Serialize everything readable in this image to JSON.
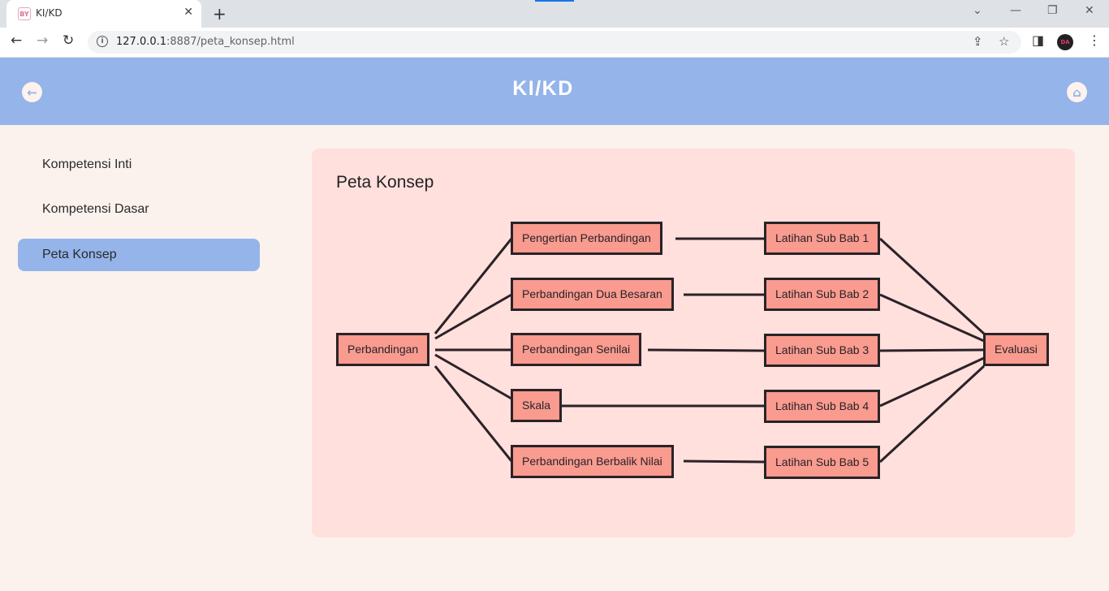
{
  "browser": {
    "tab_title": "KI/KD",
    "favicon_text": "BY",
    "url_host": "127.0.0.1",
    "url_rest": ":8887/peta_konsep.html",
    "profile_initials": "DA"
  },
  "header": {
    "title": "KI/KD",
    "back_icon": "arrow-left-icon",
    "home_icon": "home-icon"
  },
  "sidebar": {
    "items": [
      {
        "label": "Kompetensi Inti",
        "active": false
      },
      {
        "label": "Kompetensi Dasar",
        "active": false
      },
      {
        "label": "Peta Konsep",
        "active": true
      }
    ]
  },
  "content": {
    "title": "Peta Konsep",
    "nodes": {
      "root": "Perbandingan",
      "topics": [
        "Pengertian Perbandingan",
        "Perbandingan Dua Besaran",
        "Perbandingan Senilai",
        "Skala",
        "Perbandingan Berbalik Nilai"
      ],
      "exercises": [
        "Latihan Sub Bab 1",
        "Latihan Sub Bab 2",
        "Latihan Sub Bab 3",
        "Latihan Sub Bab 4",
        "Latihan Sub Bab 5"
      ],
      "final": "Evaluasi"
    }
  },
  "colors": {
    "header_bg": "#94b4ea",
    "page_bg": "#fbf2ee",
    "card_bg": "#ffe0dd",
    "node_fill": "#f99b8f",
    "node_border": "#2a2227"
  }
}
